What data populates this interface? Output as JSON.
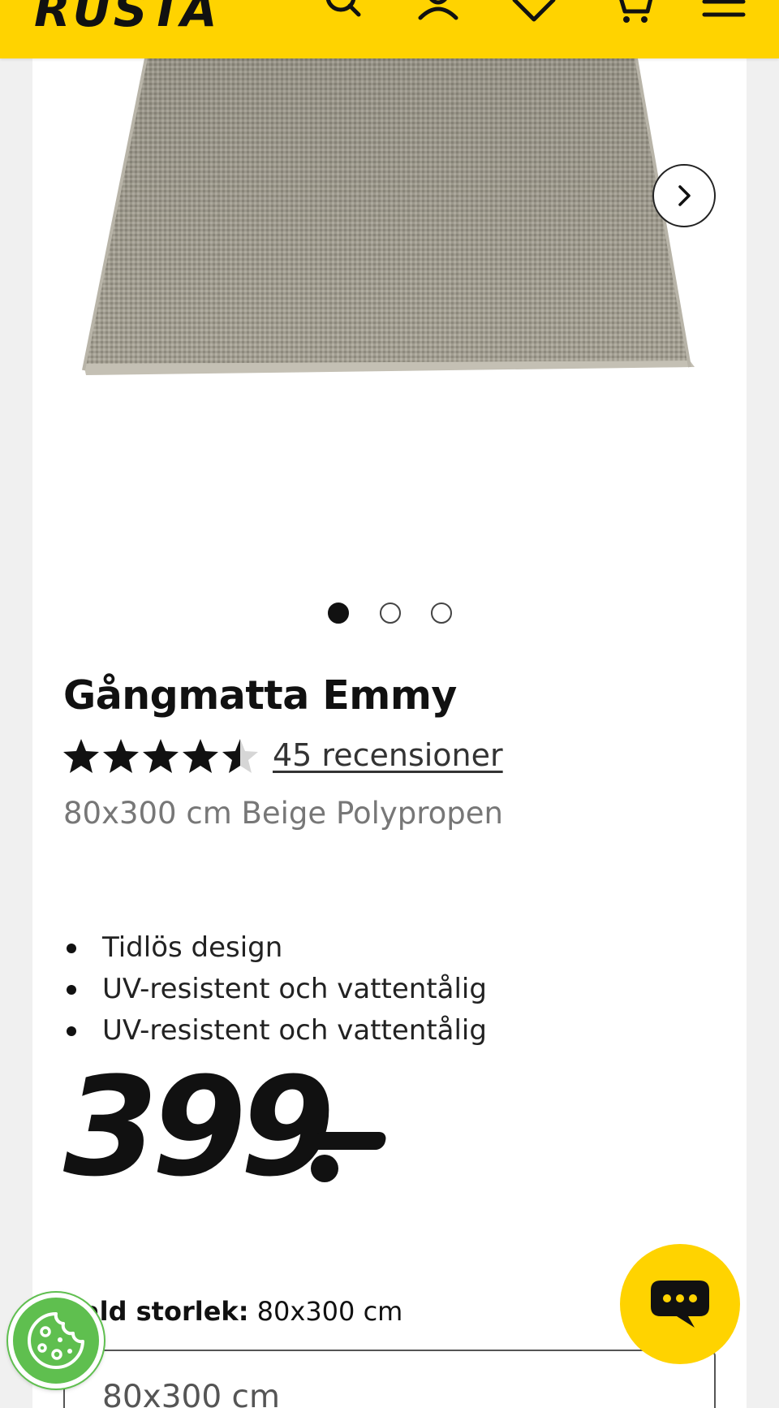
{
  "header": {
    "logo_text": "RUSTA",
    "brand_color": "#ffd300",
    "icons": [
      "search-icon",
      "account-icon",
      "heart-icon",
      "cart-icon",
      "menu-icon"
    ]
  },
  "gallery": {
    "image_alt": "Gångmatta Emmy",
    "next_icon": "chevron-right-icon",
    "dots_total": 3,
    "active_dot": 1
  },
  "product": {
    "title": "Gångmatta Emmy",
    "rating": 4.5,
    "rating_max": 5,
    "reviews_label": "45 recensioner",
    "subtitle": "80x300 cm Beige Polypropen",
    "features": [
      "Tidlös design",
      "UV-resistent och vattentålig",
      "UV-resistent och vattentålig"
    ],
    "price": "399"
  },
  "size": {
    "label_prefix": "Vald storlek:",
    "label_value": "80x300 cm",
    "selected_value": "80x300 cm"
  },
  "widgets": {
    "cookie_icon": "cookie-icon",
    "chat_icon": "chat-icon",
    "cookie_color": "#5fbf4f",
    "chat_color": "#ffd300"
  }
}
